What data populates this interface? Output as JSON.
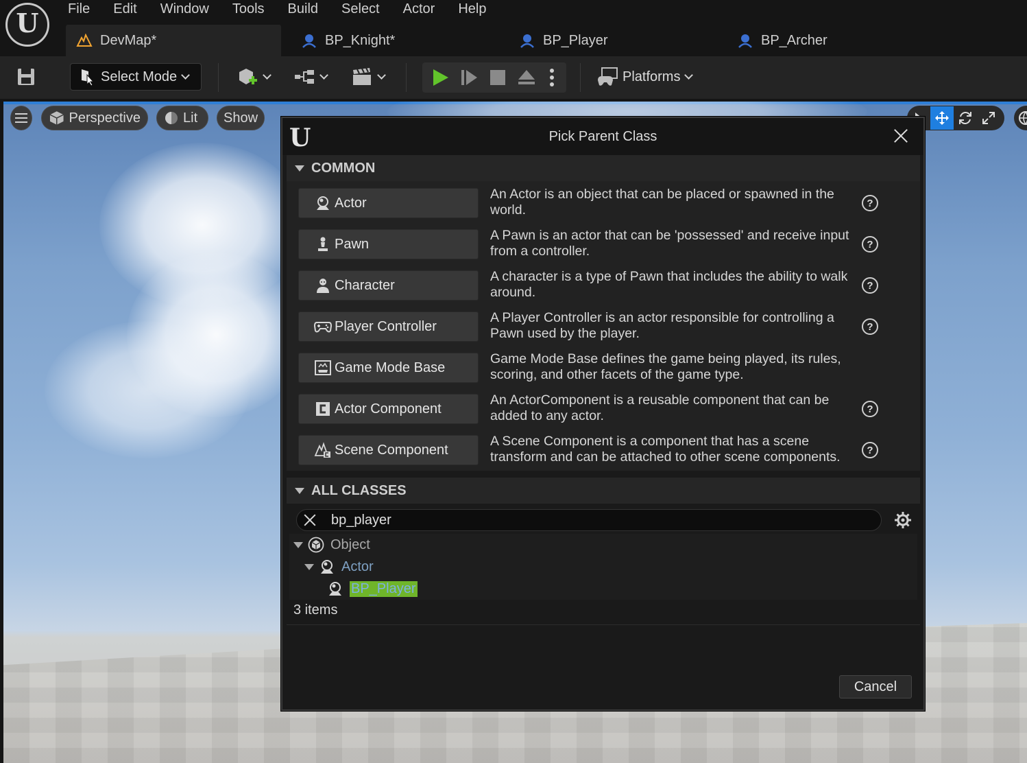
{
  "menu": [
    "File",
    "Edit",
    "Window",
    "Tools",
    "Build",
    "Select",
    "Actor",
    "Help"
  ],
  "tabs": [
    {
      "label": "DevMap*",
      "active": true
    },
    {
      "label": "BP_Knight*",
      "active": false
    },
    {
      "label": "BP_Player",
      "active": false
    },
    {
      "label": "BP_Archer",
      "active": false
    }
  ],
  "toolbar": {
    "select_mode": "Select Mode",
    "platforms": "Platforms"
  },
  "viewport": {
    "perspective": "Perspective",
    "lit": "Lit",
    "show": "Show"
  },
  "dialog": {
    "title": "Pick Parent Class",
    "common_header": "COMMON",
    "all_classes_header": "ALL CLASSES",
    "classes": [
      {
        "label": "Actor",
        "icon": "actor-icon",
        "description": "An Actor is an object that can be placed or spawned in the world.",
        "help": true
      },
      {
        "label": "Pawn",
        "icon": "pawn-icon",
        "description": "A Pawn is an actor that can be 'possessed' and receive input from a controller.",
        "help": true
      },
      {
        "label": "Character",
        "icon": "character-icon",
        "description": "A character is a type of Pawn that includes the ability to walk around.",
        "help": true
      },
      {
        "label": "Player Controller",
        "icon": "gamepad-icon",
        "description": "A Player Controller is an actor responsible for controlling a Pawn used by the player.",
        "help": true
      },
      {
        "label": "Game Mode Base",
        "icon": "game-mode-icon",
        "description": "Game Mode Base defines the game being played, its rules, scoring, and other facets of the game type.",
        "help": false
      },
      {
        "label": "Actor Component",
        "icon": "component-icon",
        "description": "An ActorComponent is a reusable component that can be added to any actor.",
        "help": true
      },
      {
        "label": "Scene Component",
        "icon": "scene-component-icon",
        "description": "A Scene Component is a component that has a scene transform and can be attached to other scene components.",
        "help": true
      }
    ],
    "search": {
      "value": "bp_player"
    },
    "tree": [
      {
        "label": "Object",
        "depth": 0
      },
      {
        "label": "Actor",
        "depth": 1
      },
      {
        "label": "BP_Player",
        "depth": 2
      }
    ],
    "item_count": "3 items",
    "cancel_label": "Cancel"
  },
  "colors": {
    "accent": "#1f7fe0",
    "play_green": "#62c42b",
    "highlight": "#6fb52a"
  }
}
